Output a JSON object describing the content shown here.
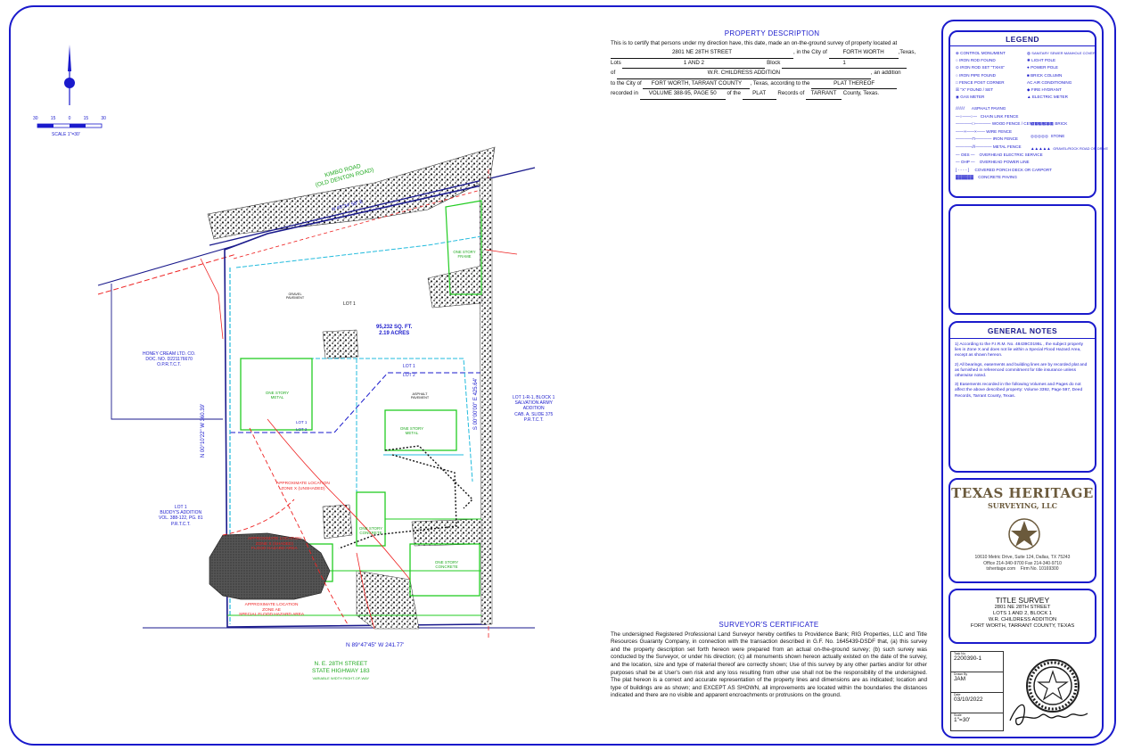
{
  "property_description": {
    "title": "PROPERTY DESCRIPTION",
    "intro": "This is to certify that persons under my direction have, this date, made an on-the-ground survey of property located at",
    "address": "2801 NE 28TH STREET",
    "city_prefix": ", in the City of",
    "city": "FORTH WORTH",
    "state_suffix": ",Texas,",
    "lots_label": "Lots",
    "lots": "1 AND 2",
    "block_label": "Block",
    "block": "1",
    "of_label": "of",
    "addition": "W.R. CHILDRESS ADDITION",
    "addition_suffix": ", an addition",
    "to_city_label": "to the City of",
    "city_county": "FORT WORTH, TARRANT COUNTY",
    "texas_according": ", Texas, according to the",
    "plat_thereof": "PLAT THEREOF",
    "recorded_label": "recorded in",
    "volume": "VOLUME 388-95, PAGE 50",
    "of_the": "of the",
    "plat": "PLAT",
    "records_of": "Records of",
    "county": "TARRANT",
    "county_suffix": "County, Texas."
  },
  "scale": {
    "ticks": [
      "30",
      "15",
      "0",
      "15",
      "30"
    ],
    "label": "SCALE 1\"=30'"
  },
  "map": {
    "road_name": "KIMBO ROAD",
    "road_alt": "(OLD DENTON ROAD)",
    "street_name": "N. E. 28TH STREET",
    "highway": "STATE HIGHWAY 183",
    "row_note": "VARIABLE WIDTH RIGHT-OF-WAY",
    "lot1": "LOT 1",
    "lot2": "LOT 2",
    "area": "95,232 SQ. FT.",
    "acres": "2.19 ACRES",
    "bearing_west": "N 00°10'22\" W   360.39'",
    "bearing_east": "S 00°00'00\" E   425.64'",
    "bearing_south": "N 89°47'45\" W   241.77'",
    "bearing_north": "N 45°34' 58\" E",
    "honey_cream": "HONEY CREAM LTD. CO.",
    "honey_doc": "DOC. NO. D221176670",
    "honey_rec": "O.P.R.T.C.T.",
    "salvation_1": "LOT 1-R-1, BLOCK 1",
    "salvation_2": "SALVATION ARMY",
    "salvation_3": "ADDITION",
    "salvation_4": "CAB. A, SLIDE 375",
    "salvation_5": "P.R.T.C.T.",
    "buddy_1": "LOT 1",
    "buddy_2": "BUDDY'S ADDITION",
    "buddy_3": "VOL. 388-122, PG. 81",
    "buddy_4": "P.R.T.C.T.",
    "flood_1": "APPROXIMATE LOCATION",
    "flood_2": "ZONE X (SHADED)",
    "flood_3": "FLOOD HAZARD AREA",
    "zone_ae_1": "APPROXIMATE LOCATION",
    "zone_ae_2": "ZONE AE",
    "zone_ae_3": "SPECIAL FLOOD HAZARD AREA",
    "zone_x_1": "APPROXIMATE LOCATION",
    "zone_x_2": "ZONE X (UNSHADED)",
    "bldg_metal_1": "ONE STORY METAL",
    "bldg_metal_2": "ONE STORY METAL",
    "bldg_concrete_1": "ONE STORY CONCRETE",
    "bldg_concrete_2": "ONE STORY CONCRETE",
    "bldg_frame": "ONE STORY FRAME",
    "gravel": "GRAVEL PAVEMENT",
    "asphalt": "ASPHALT PAVEMENT"
  },
  "legend": {
    "title": "LEGEND",
    "left": [
      "CONTROL MONUMENT",
      "IRON ROD FOUND",
      "IRON ROD SET \"TXHS\"",
      "IRON PIPE FOUND",
      "FENCE POST CORNER",
      "\"X\" FOUND / SET",
      "GAS METER"
    ],
    "right": [
      "SANITARY SEWER MANHOLE COVER",
      "LIGHT POLE",
      "POWER POLE",
      "BRICK COLUMN",
      "AIR CONDITIONING",
      "FIRE HYDRANT",
      "ELECTRIC METER"
    ],
    "lines": [
      "ASPHALT PAVING",
      "CHAIN LINK FENCE",
      "WOOD FENCE / CENTER POST",
      "WIRE FENCE",
      "IRON FENCE",
      "METAL FENCE",
      "OVERHEAD ELECTRIC SERVICE",
      "OVERHEAD POWER LINE",
      "COVERED PORCH DECK OR CARPORT",
      "CONCRETE PAVING"
    ],
    "hatch": [
      "BRICK",
      "STONE",
      "GRAVEL/ROCK ROAD OR DRIVE"
    ]
  },
  "general_notes": {
    "title": "GENERAL NOTES",
    "note1": "1) According to the F.I.R.M. No. 48439C0195L , the subject property lies in Zone X and does not lie within a Special Flood Hazard Area, except as shown hereon.",
    "note2": "2) All bearings, easements and building lines are by recorded plat and as furnished in referenced commitment for title insurance unless otherwise noted.",
    "note3": "3) Easements recorded in the following Volumes and Pages do not affect the above described property: Volume 3392, Page 597, Deed Records, Tarrant County, Texas."
  },
  "company": {
    "name": "TEXAS HERITAGE",
    "sub": "SURVEYING, LLC",
    "address": "10610 Metric Drive, Suite 124, Dallas, TX 75243",
    "phone": "Office 214-340-9700   Fax 214-340-9710",
    "web": "txheritage.com",
    "firm": "Firm No. 10169300"
  },
  "title_survey": {
    "title": "TITLE SURVEY",
    "line1": "2801 NE 28TH STREET",
    "line2": "LOTS 1 AND 2, BLOCK 1",
    "line3": "W.R. CHILDRESS ADDITION",
    "line4": "FORT WORTH, TARRANT COUNTY, TEXAS"
  },
  "job": {
    "task_label": "Task No.",
    "task": "2200390-1",
    "drawn_label": "Drawn By",
    "drawn": "JAM",
    "date_label": "Date",
    "date": "03/10/2022",
    "scale_label": "Scale",
    "scale": "1\"=30'"
  },
  "certificate": {
    "title": "SURVEYOR'S CERTIFICATE",
    "body": "The undersigned Registered Professional Land Surveyor hereby certifies to Providence Bank; RIG Properties, LLC and Title Resources Guaranty Company, in connection with the transaction described in G.F. No. 1645439-DSDF that, (a) this survey and the property description set forth hereon were prepared from an actual on-the-ground survey; (b) such survey was conducted by the Surveyor, or under his direction; (c) all monuments shown hereon actually existed on the date of the survey, and the location, size and type of material thereof are correctly shown; Use of this survey by any other parties and/or for other purposes shall be at User's own risk and any loss resulting from other use shall not be the responsibility of the undersigned. The plat hereon is a correct and accurate representation of the property lines and dimensions are as indicated; location and type of buildings are as shown; and EXCEPT AS SHOWN, all improvements are located within the boundaries the distances indicated and there are no visible and apparent encroachments or protrusions on the ground."
  },
  "colors": {
    "border": "#1a1acc",
    "boundary": "#1a1a8c",
    "fence_cyan": "#22bbdd",
    "building_green": "#22cc22",
    "easement_red": "#ee2222",
    "flood_dark": "#444444"
  },
  "icons": [
    "north-arrow-icon",
    "company-star-logo",
    "surveyor-seal",
    "surveyor-signature"
  ]
}
